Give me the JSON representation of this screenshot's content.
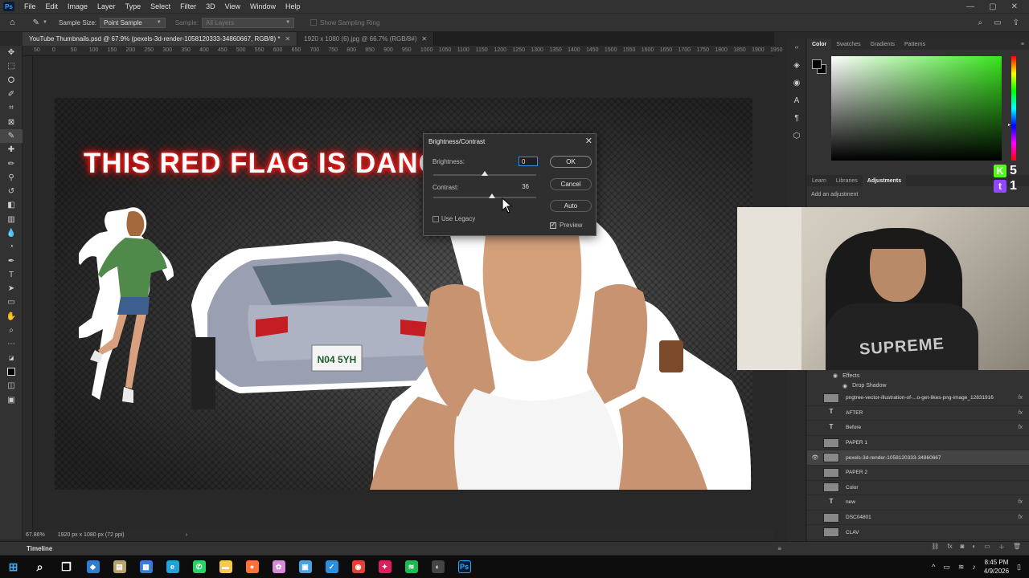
{
  "menubar": {
    "items": [
      "File",
      "Edit",
      "Image",
      "Layer",
      "Type",
      "Select",
      "Filter",
      "3D",
      "View",
      "Window",
      "Help"
    ]
  },
  "options": {
    "sample_size_label": "Sample Size:",
    "sample_size_value": "Point Sample",
    "sample_label": "Sample:",
    "sample_value": "All Layers",
    "show_ring": "Show Sampling Ring"
  },
  "doc_tabs": [
    {
      "title": "YouTube Thumbnails.psd @ 67.9% (pexels-3d-render-1058120333-34860667, RGB/8) *",
      "active": true
    },
    {
      "title": "1920 x 1080 (6).jpg @ 66.7% (RGB/8#)",
      "active": false
    }
  ],
  "ruler": [
    "50",
    "0",
    "50",
    "100",
    "150",
    "200",
    "250",
    "300",
    "350",
    "400",
    "450",
    "500",
    "550",
    "600",
    "650",
    "700",
    "750",
    "800",
    "850",
    "900",
    "950",
    "1000",
    "1050",
    "1100",
    "1150",
    "1200",
    "1250",
    "1300",
    "1350",
    "1400",
    "1450",
    "1500",
    "1550",
    "1600",
    "1650",
    "1700",
    "1750",
    "1800",
    "1850",
    "1900",
    "1950"
  ],
  "canvas": {
    "headline": "THIS RED FLAG IS DANGER",
    "plate_text": "N04 5YH"
  },
  "dialog": {
    "title": "Brightness/Contrast",
    "brightness_label": "Brightness:",
    "brightness_value": "0",
    "contrast_label": "Contrast:",
    "contrast_value": "36",
    "use_legacy_label": "Use Legacy",
    "use_legacy_checked": false,
    "preview_label": "Preview",
    "preview_checked": true,
    "ok_label": "OK",
    "cancel_label": "Cancel",
    "auto_label": "Auto"
  },
  "status": {
    "zoom": "67.86%",
    "doc_size": "1920 px x 1080 px (72 ppi)"
  },
  "timeline_label": "Timeline",
  "color_panel": {
    "tabs": [
      "Color",
      "Swatches",
      "Gradients",
      "Patterns"
    ],
    "active": "Color",
    "field_hue": "#39e61e"
  },
  "adjust_panel": {
    "tabs": [
      "Learn",
      "Libraries",
      "Adjustments"
    ],
    "active": "Adjustments",
    "hint": "Add an adjustment"
  },
  "badges": [
    {
      "icon": "kick-icon",
      "label": "K",
      "count": "5",
      "color": "#53fc18"
    },
    {
      "icon": "twitch-icon",
      "label": "t",
      "count": "1",
      "color": "#9146ff"
    }
  ],
  "webcam": {
    "shirt_text": "SUPREME"
  },
  "layers": {
    "effects_label": "Effects",
    "drop_shadow_label": "Drop Shadow",
    "items": [
      {
        "name": "pngtree-vector-illustration-of-...o-get-likes-png-image_12831916",
        "type": "image",
        "fx": true,
        "visible": false,
        "selected": false
      },
      {
        "name": "AFTER",
        "type": "text",
        "fx": true,
        "visible": false,
        "selected": false
      },
      {
        "name": "Before",
        "type": "text",
        "fx": true,
        "visible": false,
        "selected": false
      },
      {
        "name": "PAPER 1",
        "type": "image",
        "fx": false,
        "visible": false,
        "selected": false
      },
      {
        "name": "pexels-3d-render-1058120333-34860667",
        "type": "image",
        "fx": false,
        "visible": true,
        "selected": true
      },
      {
        "name": "PAPER 2",
        "type": "image",
        "fx": false,
        "visible": false,
        "selected": false
      },
      {
        "name": "Color",
        "type": "image",
        "fx": false,
        "visible": false,
        "selected": false
      },
      {
        "name": "new",
        "type": "text",
        "fx": true,
        "visible": false,
        "selected": false
      },
      {
        "name": "DSC04801",
        "type": "image",
        "fx": true,
        "visible": false,
        "selected": false
      },
      {
        "name": "CLAV",
        "type": "image",
        "fx": false,
        "visible": false,
        "selected": false
      }
    ]
  },
  "taskbar": {
    "time": "8:45 PM",
    "date": "4/9/2026",
    "apps": [
      {
        "icon": "windows-start-icon",
        "glyph": "⊞",
        "color": "#3fa9f5"
      },
      {
        "icon": "search-icon",
        "glyph": "⌕",
        "color": "#ffffff"
      },
      {
        "icon": "task-view-icon",
        "glyph": "❐",
        "color": "#ffffff"
      },
      {
        "icon": "store-icon",
        "glyph": "◆",
        "color": "#2d7dd2"
      },
      {
        "icon": "app-icon",
        "glyph": "▤",
        "color": "#b8a36a"
      },
      {
        "icon": "calculator-icon",
        "glyph": "▦",
        "color": "#3a7bd5"
      },
      {
        "icon": "edge-icon",
        "glyph": "e",
        "color": "#1fa3d9"
      },
      {
        "icon": "whatsapp-icon",
        "glyph": "✆",
        "color": "#25d366"
      },
      {
        "icon": "file-explorer-icon",
        "glyph": "▬",
        "color": "#f7c948"
      },
      {
        "icon": "firefox-icon",
        "glyph": "●",
        "color": "#ff7139"
      },
      {
        "icon": "paint-icon",
        "glyph": "✿",
        "color": "#d98ad9"
      },
      {
        "icon": "photos-icon",
        "glyph": "▣",
        "color": "#4aa3df"
      },
      {
        "icon": "vscode-icon",
        "glyph": "✓",
        "color": "#2b8fe0"
      },
      {
        "icon": "chrome-icon",
        "glyph": "◉",
        "color": "#e34133"
      },
      {
        "icon": "slack-icon",
        "glyph": "✦",
        "color": "#e01e5a"
      },
      {
        "icon": "spotify-icon",
        "glyph": "≋",
        "color": "#1db954"
      },
      {
        "icon": "app-icon-dark",
        "glyph": "◐",
        "color": "#444444"
      },
      {
        "icon": "photoshop-icon",
        "glyph": "Ps",
        "color": "#0b1b33"
      }
    ]
  },
  "colors": {
    "accent": "#3d8fe6",
    "headline_glow": "#ff1a1a"
  }
}
